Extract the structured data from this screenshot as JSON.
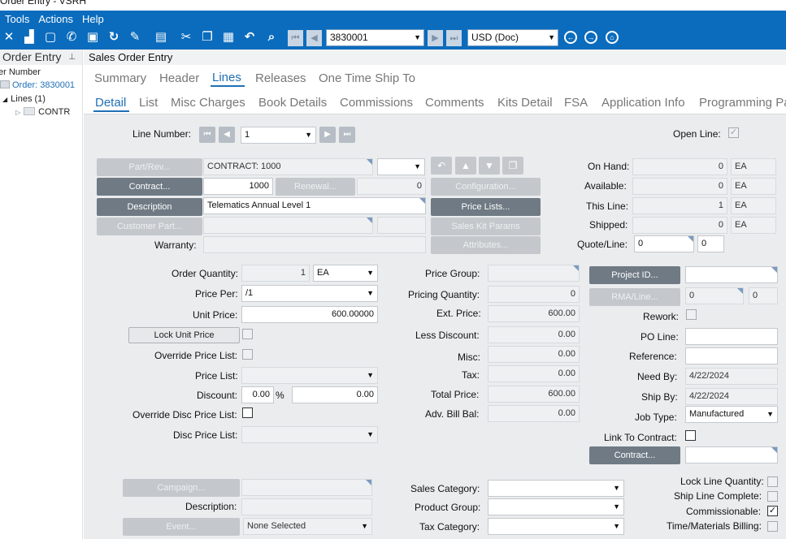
{
  "window": {
    "title": "Order Entry - VSRH"
  },
  "menu": [
    "Tools",
    "Actions",
    "Help"
  ],
  "toolbar": {
    "order_combo": "3830001",
    "currency_combo": "USD (Doc)"
  },
  "tree": {
    "header": "Order Entry",
    "items": [
      "er Number",
      "Order: 3830001",
      "Lines (1)",
      "CONTR"
    ]
  },
  "form_title": "Sales Order Entry",
  "tabs_top": [
    "Summary",
    "Header",
    "Lines",
    "Releases",
    "One Time Ship To"
  ],
  "tabs_sub": [
    "Detail",
    "List",
    "Misc Charges",
    "Book Details",
    "Commissions",
    "Comments",
    "Kits Detail",
    "FSA",
    "Application Info",
    "Programming Pa"
  ],
  "line": {
    "line_number_label": "Line Number:",
    "line_number": "1",
    "open_line_label": "Open Line:"
  },
  "part": {
    "part_rev_btn": "Part/Rev...",
    "part_value": "CONTRACT: 1000",
    "contract_btn": "Contract...",
    "contract_value": "1000",
    "renewal_btn": "Renewal...",
    "renewal_value": "0",
    "description_btn": "Description",
    "description_value": "Telematics Annual Level 1",
    "customer_part_btn": "Customer Part...",
    "warranty_label": "Warranty:",
    "configuration_btn": "Configuration...",
    "price_lists_btn": "Price Lists...",
    "sales_kit_btn": "Sales Kit Params",
    "attributes_btn": "Attributes..."
  },
  "qty": {
    "on_hand_label": "On Hand:",
    "on_hand": "0",
    "available_label": "Available:",
    "available": "0",
    "this_line_label": "This Line:",
    "this_line": "1",
    "shipped_label": "Shipped:",
    "shipped": "0",
    "uom": "EA",
    "quote_line_label": "Quote/Line:",
    "quote": "0",
    "quote_line": "0"
  },
  "pricing": {
    "order_qty_label": "Order Quantity:",
    "order_qty": "1",
    "order_uom": "EA",
    "price_per_label": "Price Per:",
    "price_per": "/1",
    "unit_price_label": "Unit Price:",
    "unit_price": "600.00000",
    "lock_unit_price_btn": "Lock Unit Price",
    "override_price_list_label": "Override Price List:",
    "price_list_label": "Price List:",
    "discount_label": "Discount:",
    "discount_pct": "0.00",
    "pct_sign": "%",
    "discount_amt": "0.00",
    "override_disc_label": "Override Disc Price List:",
    "disc_price_list_label": "Disc Price List:"
  },
  "totals": {
    "price_group_label": "Price Group:",
    "pricing_qty_label": "Pricing Quantity:",
    "pricing_qty": "0",
    "ext_price_label": "Ext. Price:",
    "ext_price": "600.00",
    "less_discount_label": "Less Discount:",
    "less_discount": "0.00",
    "misc_label": "Misc:",
    "misc": "0.00",
    "tax_label": "Tax:",
    "tax": "0.00",
    "total_price_label": "Total Price:",
    "total_price": "600.00",
    "adv_bill_label": "Adv. Bill Bal:",
    "adv_bill": "0.00"
  },
  "right": {
    "project_btn": "Project ID...",
    "rma_btn": "RMA/Line...",
    "rma": "0",
    "rma_line": "0",
    "rework_label": "Rework:",
    "po_line_label": "PO Line:",
    "reference_label": "Reference:",
    "need_by_label": "Need By:",
    "need_by": "4/22/2024",
    "ship_by_label": "Ship By:",
    "ship_by": "4/22/2024",
    "job_type_label": "Job Type:",
    "job_type": "Manufactured",
    "link_contract_label": "Link To Contract:",
    "contract_btn": "Contract..."
  },
  "bottom": {
    "campaign_btn": "Campaign...",
    "description_label": "Description:",
    "event_btn": "Event...",
    "event_value": "None Selected",
    "sales_category_label": "Sales Category:",
    "product_group_label": "Product Group:",
    "tax_category_label": "Tax Category:",
    "lock_line_qty_label": "Lock Line Quantity:",
    "ship_line_complete_label": "Ship Line Complete:",
    "commissionable_label": "Commissionable:",
    "tm_billing_label": "Time/Materials Billing:"
  }
}
